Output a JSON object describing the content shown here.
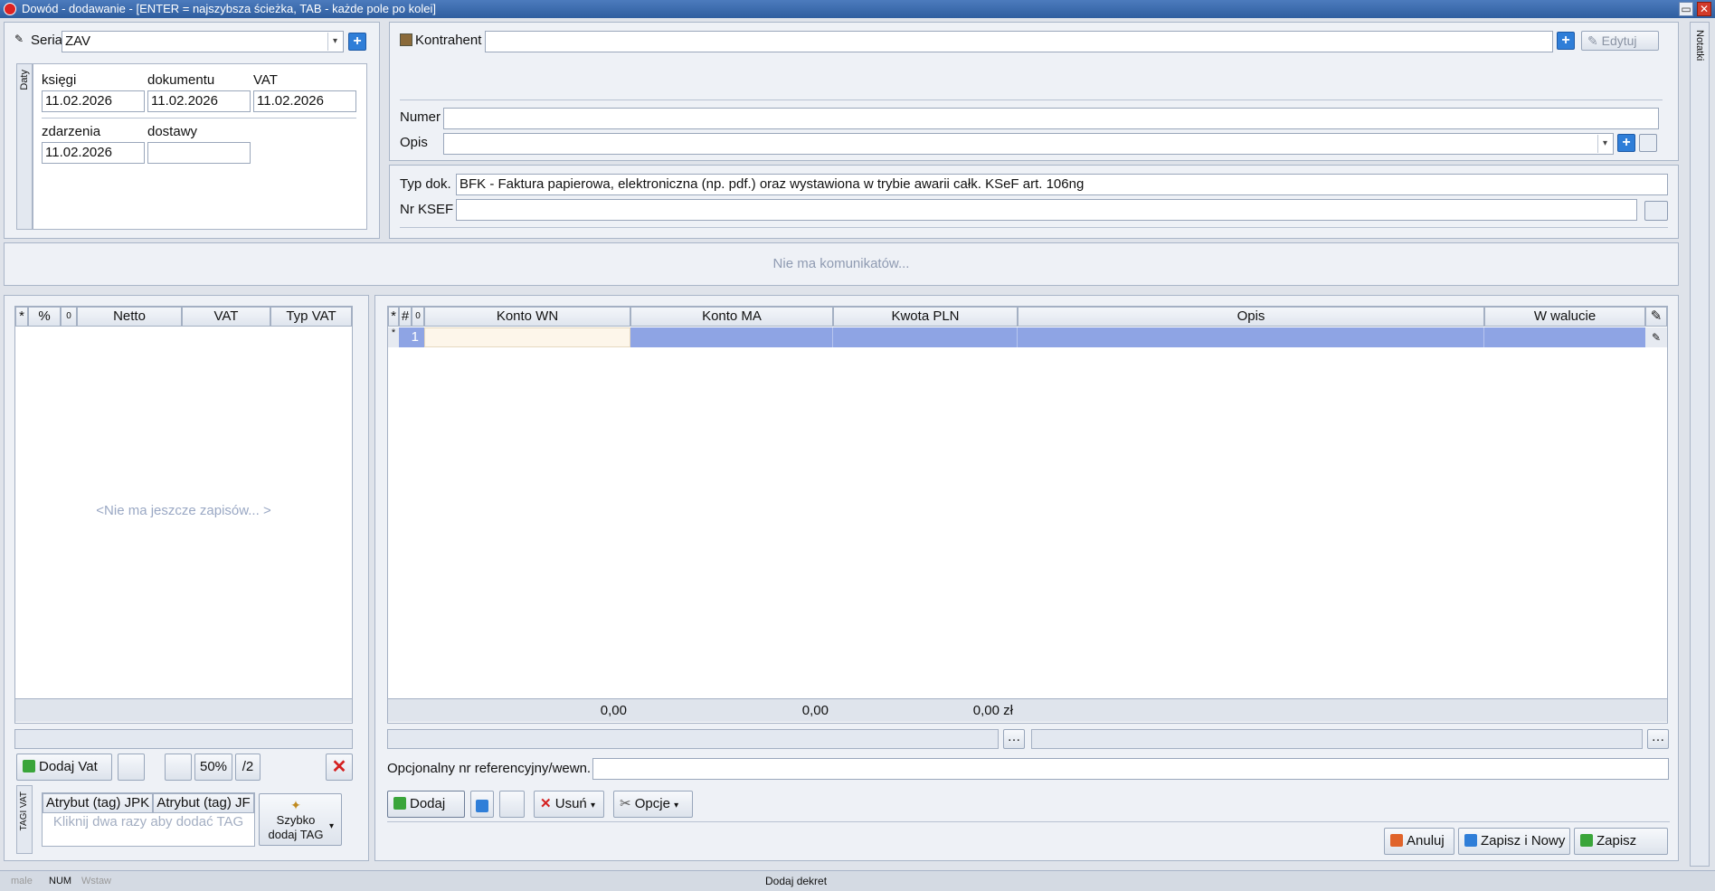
{
  "window": {
    "title": "Dowód - dodawanie - [ENTER = najszybsza ścieżka, TAB - każde pole po kolei]"
  },
  "seria": {
    "label": "Seria",
    "value": "ZAV"
  },
  "daty": {
    "tab_label": "Daty",
    "ksiegi": {
      "label": "księgi",
      "value": "11.02.2026"
    },
    "dokumentu": {
      "label": "dokumentu",
      "value": "11.02.2026"
    },
    "vat": {
      "label": "VAT",
      "value": "11.02.2026"
    },
    "zdarzenia": {
      "label": "zdarzenia",
      "value": "11.02.2026"
    },
    "dostawy": {
      "label": "dostawy",
      "value": ""
    }
  },
  "kontrahent": {
    "label": "Kontrahent",
    "value": "",
    "edit_label": "Edytuj"
  },
  "numer": {
    "label": "Numer",
    "value": ""
  },
  "opis": {
    "label": "Opis",
    "value": ""
  },
  "typ_dok": {
    "label": "Typ dok.",
    "value": "BFK - Faktura papierowa, elektroniczna (np. pdf.) oraz wystawiona w trybie awarii całk. KSeF art. 106ng"
  },
  "nr_ksef": {
    "label": "Nr KSEF",
    "value": ""
  },
  "messages": {
    "text": "Nie ma komunikatów..."
  },
  "notatki": {
    "label": "Notatki"
  },
  "vat_grid": {
    "headers": [
      "*",
      "%",
      "0",
      "Netto",
      "VAT",
      "Typ VAT"
    ],
    "empty_text": "<Nie ma jeszcze zapisów... >"
  },
  "vat_buttons": {
    "dodaj_vat": "Dodaj Vat",
    "pct50": "50%",
    "div2": "/2"
  },
  "tags": {
    "tab_label": "TAGI VAT",
    "col1": "Atrybut (tag) JPK",
    "col2": "Atrybut (tag) JF",
    "hint": "Kliknij dwa razy aby dodać TAG",
    "quick_add": "Szybko dodaj TAG"
  },
  "dekret_grid": {
    "headers": [
      "*",
      "#",
      "0",
      "Konto WN",
      "Konto MA",
      "Kwota PLN",
      "Opis",
      "W walucie"
    ],
    "rows": [
      {
        "nr": "1"
      }
    ],
    "totals": {
      "wn": "0,00",
      "ma": "0,00",
      "kwota": "0,00 zł"
    }
  },
  "ref": {
    "label": "Opcjonalny nr referencyjny/wewn.",
    "value": ""
  },
  "dekret_buttons": {
    "dodaj": "Dodaj",
    "usun": "Usuń",
    "opcje": "Opcje"
  },
  "footer_buttons": {
    "anuluj": "Anuluj",
    "zapisz_nowy": "Zapisz i Nowy",
    "zapisz": "Zapisz"
  },
  "statusbar": {
    "caps": "male",
    "num": "NUM",
    "ins": "Wstaw",
    "text": "Dodaj dekret"
  },
  "colors": {
    "selection": "#8ea4e4",
    "title_bar": "#3a6aa9",
    "plus_button": "#2f7ed8",
    "delete_red": "#d42020"
  }
}
